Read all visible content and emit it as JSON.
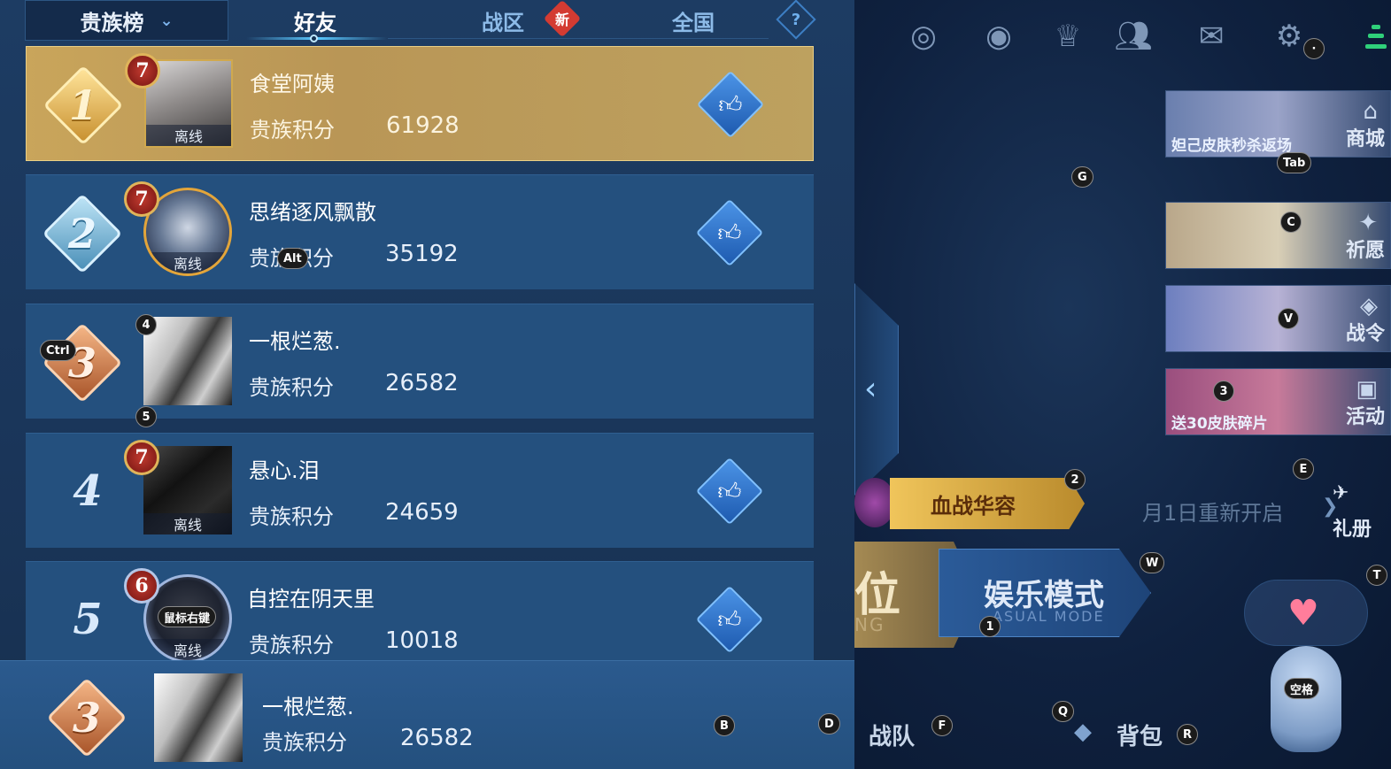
{
  "tabs": {
    "dropdown_label": "贵族榜",
    "friends": "好友",
    "region": "战区",
    "region_badge": "新",
    "national": "全国",
    "help": "?"
  },
  "rows": [
    {
      "rank": "1",
      "level": "7",
      "name": "食堂阿姨",
      "score_label": "贵族积分",
      "score": "61928",
      "status": "离线"
    },
    {
      "rank": "2",
      "level": "7",
      "name": "思绪逐风飘散",
      "score_label": "贵族积分",
      "score": "35192",
      "status": "离线"
    },
    {
      "rank": "3",
      "level": "",
      "name": "一根烂葱.",
      "score_label": "贵族积分",
      "score": "26582",
      "status": ""
    },
    {
      "rank": "4",
      "level": "7",
      "name": "悬心.泪",
      "score_label": "贵族积分",
      "score": "24659",
      "status": "离线"
    },
    {
      "rank": "5",
      "level": "6",
      "name": "自控在阴天里",
      "score_label": "贵族积分",
      "score": "10018",
      "status": "离线"
    }
  ],
  "self": {
    "rank": "3",
    "name": "一根烂葱.",
    "score_label": "贵族积分",
    "score": "26582"
  },
  "lobby": {
    "cards": [
      {
        "caption": "妲己皮肤秒杀返场",
        "label": "商城"
      },
      {
        "caption": "",
        "label": "祈愿"
      },
      {
        "caption": "",
        "label": "战令"
      },
      {
        "caption": "送30皮肤碎片",
        "label": "活动"
      }
    ],
    "gift_label": "礼册",
    "event_title": "血战华容",
    "reopen_text": "月1日重新开启",
    "mode_rank_big": "位",
    "mode_rank_sub": "NG",
    "mode_fun_big": "娱乐模式",
    "mode_fun_sub": "ASUAL MODE",
    "team_label": "战队",
    "bag_label": "背包"
  },
  "shortcut_keys": {
    "tab": "Tab",
    "g": "G",
    "c": "C",
    "v": "V",
    "three": "3",
    "e": "E",
    "two": "2",
    "w": "W",
    "t": "T",
    "one": "1",
    "space": "空格",
    "q": "Q",
    "r": "R",
    "f": "F",
    "b": "B",
    "d": "D",
    "dot": "·",
    "alt": "Alt",
    "ctrl": "Ctrl",
    "four": "4",
    "five": "5",
    "right_click": "鼠标右键"
  },
  "colors": {
    "gold_row": "#c9a55b",
    "row_blue": "#24507e",
    "accent": "#5ac8ff"
  },
  "icons": [
    "chevron-down-icon",
    "help-icon",
    "thumbs-up-icon",
    "radar-icon",
    "eye-icon",
    "trophy-icon",
    "friends-icon",
    "mail-icon",
    "gear-icon",
    "signal-icon",
    "collapse-arrow-icon",
    "heart-icon"
  ]
}
